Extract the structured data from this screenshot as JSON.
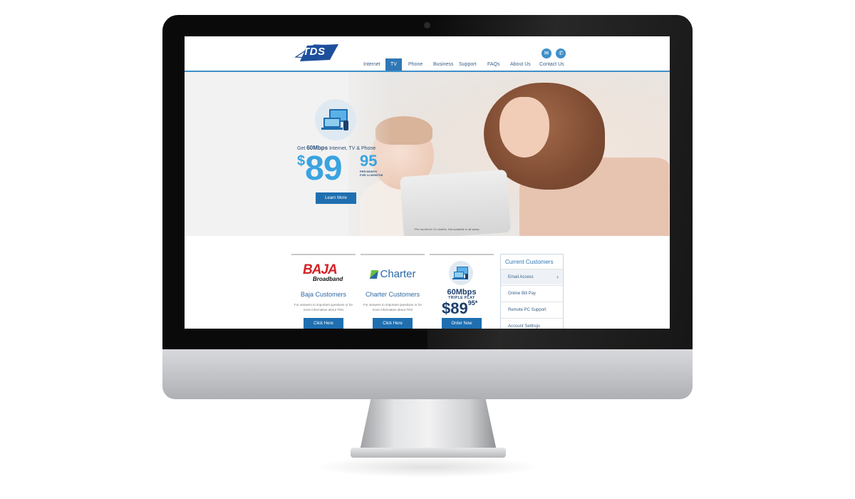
{
  "brand": {
    "logo_text": "TDS"
  },
  "header_icons": [
    "envelope-icon",
    "phone-icon"
  ],
  "nav": {
    "items": [
      "Internet",
      "TV",
      "Phone",
      "Business",
      "Support",
      "FAQs",
      "About Us",
      "Contact Us"
    ],
    "active": "TV"
  },
  "hero": {
    "promo_line_prefix": "Get ",
    "promo_line_bold": "60Mbps",
    "promo_line_suffix": " Internet, TV & Phone",
    "price_dollar": "$",
    "price_whole": "89",
    "price_cents": "95",
    "price_per_line1": "PER MONTH",
    "price_per_line2": "FOR 12 MONTHS",
    "learn_more_label": "Learn More",
    "footnote": "*Per month for 12 months. Not available in all areas."
  },
  "cards": {
    "baja": {
      "logo_big": "BAJA",
      "logo_small": "Broadband",
      "title": "Baja Customers",
      "desc": "For answers to important questions or for more information about TDS",
      "button": "Click Here"
    },
    "charter": {
      "logo": "Charter",
      "title": "Charter Customers",
      "desc": "For answers to important questions or for more information about TDS",
      "button": "Click Here"
    },
    "promo": {
      "speed": "60Mbps",
      "triple_play": "TRIPLE PLAY",
      "price_whole": "$89",
      "price_cents": "95",
      "price_star": "*",
      "button": "Order Now"
    }
  },
  "current_customers": {
    "heading": "Current Customers",
    "items": [
      "Email Access",
      "Online Bill Pay",
      "Remote PC Support",
      "Account Settings"
    ]
  }
}
